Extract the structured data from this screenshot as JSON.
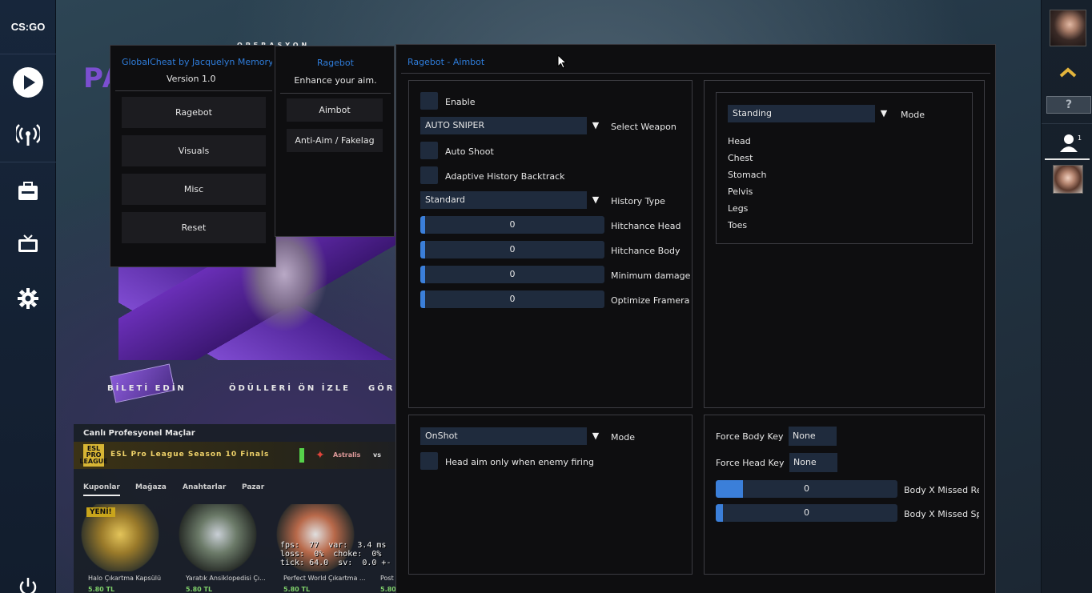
{
  "game": {
    "logo_text": "CS:GO",
    "promo_title": "PA",
    "promo_sub": "OPERASYON",
    "promo_links": [
      "BİLETİ EDİN",
      "ÖDÜLLERİ ÖN İZLE",
      "GÖR"
    ],
    "pro_title": "Canlı Profesyonel Maçlar",
    "pro_logo": "ESL PRO LEAGUE",
    "pro_league": "ESL Pro League Season 10 Finals",
    "team": "Astralis",
    "vs": "vs",
    "store_tabs": [
      "Kuponlar",
      "Mağaza",
      "Anahtarlar",
      "Pazar"
    ],
    "store_items": [
      {
        "name": "Halo Çıkartma Kapsülü",
        "price": "5.80 TL",
        "badge": "YENİ!"
      },
      {
        "name": "Yaratık Ansiklopedisi Çı...",
        "price": "5.80 TL"
      },
      {
        "name": "Perfect World Çıkartma ...",
        "price": "5.80 TL"
      },
      {
        "name": "Post",
        "price": "5.80"
      }
    ],
    "net_graph": "fps:  77  var:  3.4 ms\nloss:  0%  choke:  0%\ntick: 64.0  sv:  0.0 +-"
  },
  "main_window": {
    "title": "GlobalCheat by Jacquelyn Memoryh",
    "version": "Version 1.0",
    "menu": [
      "Ragebot",
      "Visuals",
      "Misc",
      "Reset"
    ]
  },
  "sub_window": {
    "title": "Ragebot",
    "subtitle": "Enhance your aim.",
    "items": [
      "Aimbot",
      "Anti-Aim / Fakelag"
    ]
  },
  "aimbot_window": {
    "title": "Ragebot - Aimbot",
    "enable_label": "Enable",
    "weapon": {
      "value": "AUTO SNIPER",
      "label": "Select Weapon"
    },
    "auto_shoot_label": "Auto Shoot",
    "backtrack_label": "Adaptive History Backtrack",
    "history": {
      "value": "Standard",
      "label": "History Type"
    },
    "sliders": [
      {
        "label": "Hitchance Head",
        "value": "0",
        "fill": 0
      },
      {
        "label": "Hitchance Body",
        "value": "0",
        "fill": 0
      },
      {
        "label": "Minimum damage",
        "value": "0",
        "fill": 0
      },
      {
        "label": "Optimize Framera",
        "value": "0",
        "fill": 0
      }
    ],
    "hitbox_mode": {
      "value": "Standing",
      "label": "Mode"
    },
    "hitboxes": [
      "Head",
      "Chest",
      "Stomach",
      "Pelvis",
      "Legs",
      "Toes"
    ],
    "shot_mode": {
      "value": "OnShot",
      "label": "Mode"
    },
    "head_aim_label": "Head aim only when enemy firing",
    "force_body": {
      "label": "Force Body Key",
      "value": "None"
    },
    "force_head": {
      "label": "Force Head Key",
      "value": "None"
    },
    "missed_sliders": [
      {
        "label": "Body X Missed Re",
        "value": "0",
        "fill": 0.15
      },
      {
        "label": "Body X Missed Sp",
        "value": "0",
        "fill": 0.04
      }
    ]
  },
  "colors": {
    "accent": "#3b7fd9",
    "title_blue": "#2f7ddb",
    "panel_bg": "#0e0e10",
    "control_bg": "#1f2b3d"
  }
}
